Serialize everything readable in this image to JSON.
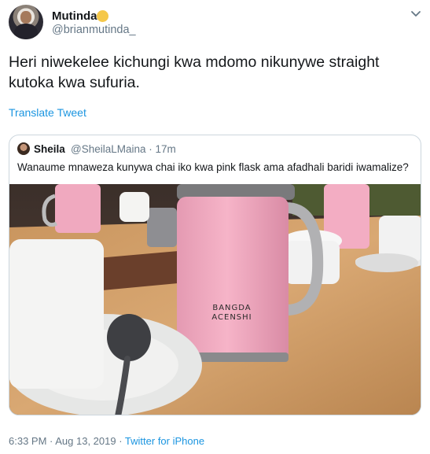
{
  "author": {
    "display_name": "Mutinda",
    "handle": "@brianmutinda_",
    "verified_emoji": "sun-emoji"
  },
  "tweet": {
    "text": "Heri niwekelee kichungi kwa mdomo nikunywe straight kutoka kwa sufuria.",
    "translate_label": "Translate Tweet"
  },
  "quoted_tweet": {
    "display_name": "Sheila",
    "meta": "@SheilaLMaina · 17m",
    "text": "Wanaume mnaweza kunywa chai iko kwa pink flask ama afadhali baridi iwamalize?",
    "photo": {
      "mug_brand_line1": "BANGDA",
      "mug_brand_line2": "ACENSHI"
    }
  },
  "footer": {
    "timestamp": "6:33 PM · Aug 13, 2019 · ",
    "source": "Twitter for iPhone"
  },
  "colors": {
    "link": "#1b95e0",
    "secondary_text": "#657786",
    "border": "#ccd6dd",
    "mug_pink": "#f2a7bd"
  }
}
